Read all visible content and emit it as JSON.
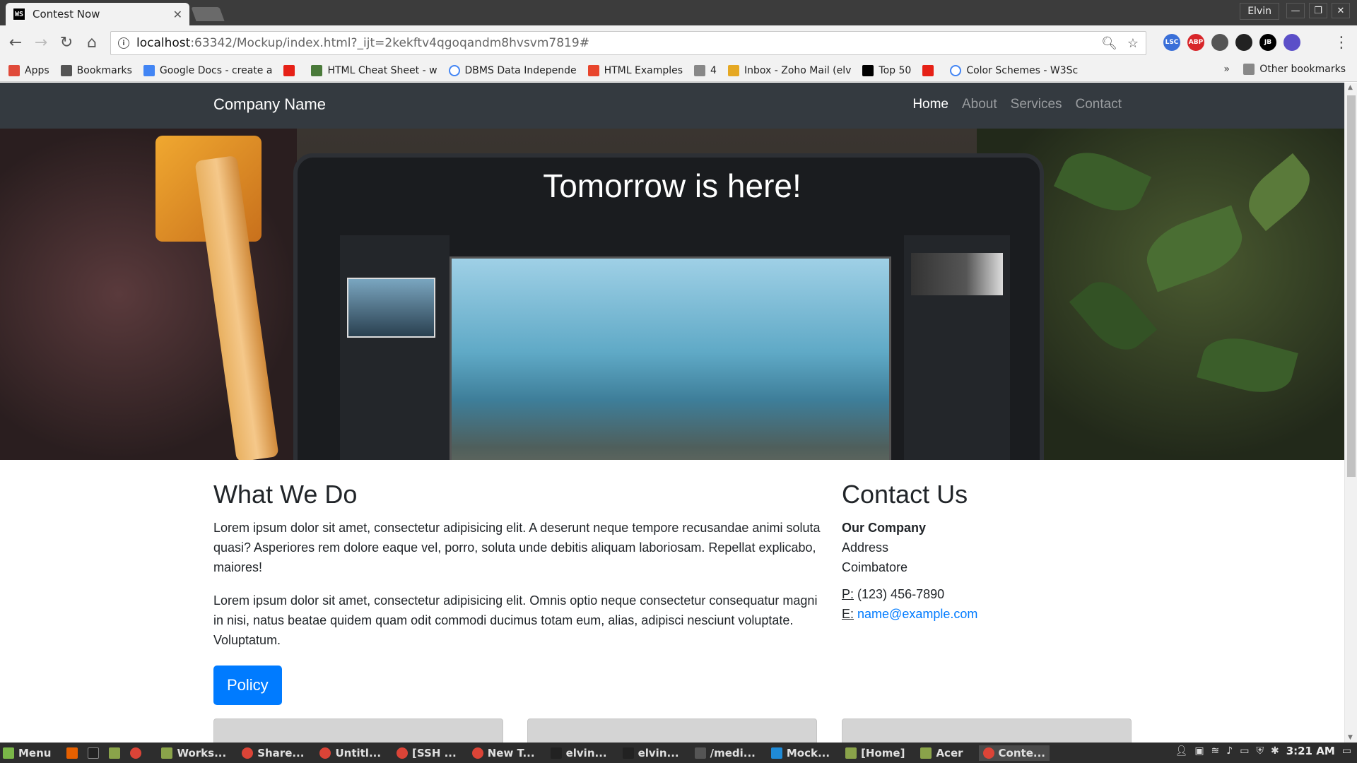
{
  "browser": {
    "tab_title": "Contest Now",
    "tab_favicon": "WS",
    "profile_name": "Elvin",
    "url_host": "localhost",
    "url_rest": ":63342/Mockup/index.html?_ijt=2kekftv4qgoqandm8hvsvm7819#",
    "window_buttons": [
      "—",
      "❐",
      "✕"
    ],
    "extensions": [
      {
        "icon": "lsc-icon",
        "label": "LSC",
        "color": "#3a6fd8"
      },
      {
        "icon": "adblock-icon",
        "label": "ABP",
        "color": "#d8262a"
      },
      {
        "icon": "incognito-icon",
        "label": "",
        "color": "#555555"
      },
      {
        "icon": "contrast-icon",
        "label": "",
        "color": "#222222"
      },
      {
        "icon": "jetbrains-icon",
        "label": "JB",
        "color": "#000000"
      },
      {
        "icon": "extension-icon",
        "label": "",
        "color": "#5b4fc8"
      }
    ]
  },
  "bookmarks": {
    "items": [
      {
        "label": "Apps",
        "icon": "apps-grid-icon",
        "color": "#e04a3a"
      },
      {
        "label": "Bookmarks",
        "icon": "star-icon",
        "color": "#555555"
      },
      {
        "label": "Google Docs - create a",
        "icon": "google-docs-icon",
        "color": "#4285f4"
      },
      {
        "label": "",
        "icon": "youtube-icon",
        "color": "#e62117"
      },
      {
        "label": "HTML Cheat Sheet - w",
        "icon": "html-icon",
        "color": "#4a7a3a"
      },
      {
        "label": "DBMS Data Independe",
        "icon": "google-icon",
        "color": "#ffffff"
      },
      {
        "label": "HTML Examples",
        "icon": "fire-icon",
        "color": "#e8452c"
      },
      {
        "label": "4",
        "icon": "page-icon",
        "color": "#888888"
      },
      {
        "label": "Inbox - Zoho Mail (elv",
        "icon": "mail-icon",
        "color": "#e5a823"
      },
      {
        "label": "Top 50",
        "icon": "e-letter-icon",
        "color": "#000000"
      },
      {
        "label": "",
        "icon": "youtube-icon",
        "color": "#e62117"
      },
      {
        "label": "Color Schemes - W3Sc",
        "icon": "google-icon",
        "color": "#ffffff"
      }
    ],
    "overflow": "»",
    "other": "Other bookmarks"
  },
  "site": {
    "brand": "Company Name",
    "nav": [
      "Home",
      "About",
      "Services",
      "Contact"
    ],
    "hero_title": "Tomorrow is here!",
    "what_we_do": {
      "heading": "What We Do",
      "p1": "Lorem ipsum dolor sit amet, consectetur adipisicing elit. A deserunt neque tempore recusandae animi soluta quasi? Asperiores rem dolore eaque vel, porro, soluta unde debitis aliquam laboriosam. Repellat explicabo, maiores!",
      "p2": "Lorem ipsum dolor sit amet, consectetur adipisicing elit. Omnis optio neque consectetur consequatur magni in nisi, natus beatae quidem quam odit commodi ducimus totam eum, alias, adipisci nesciunt voluptate. Voluptatum.",
      "button": "Policy"
    },
    "contact": {
      "heading": "Contact Us",
      "company": "Our Company",
      "address_line1": "Address",
      "address_line2": "Coimbatore",
      "phone_label": "P:",
      "phone": "(123) 456-7890",
      "email_label": "E:",
      "email": "name@example.com"
    }
  },
  "taskbar": {
    "menu": "Menu",
    "items": [
      {
        "label": "Works...",
        "icon": "folder-icon",
        "color": "#8aa34a"
      },
      {
        "label": "Share...",
        "icon": "chrome-icon",
        "color": "#db4437"
      },
      {
        "label": "Untitl...",
        "icon": "chrome-icon",
        "color": "#db4437"
      },
      {
        "label": "[SSH ...",
        "icon": "chrome-icon",
        "color": "#db4437"
      },
      {
        "label": "New T...",
        "icon": "chrome-icon",
        "color": "#db4437"
      },
      {
        "label": "elvin...",
        "icon": "terminal-icon",
        "color": "#222222"
      },
      {
        "label": "elvin...",
        "icon": "terminal-icon",
        "color": "#222222"
      },
      {
        "label": "/medi...",
        "icon": "sublime-icon",
        "color": "#555555"
      },
      {
        "label": "Mock...",
        "icon": "webstorm-icon",
        "color": "#1f8ad6"
      },
      {
        "label": "[Home]",
        "icon": "folder-icon",
        "color": "#8aa34a"
      },
      {
        "label": "Acer",
        "icon": "folder-icon",
        "color": "#8aa34a"
      },
      {
        "label": "Conte...",
        "icon": "chrome-icon",
        "color": "#db4437"
      }
    ],
    "clock": "3:21 AM"
  }
}
